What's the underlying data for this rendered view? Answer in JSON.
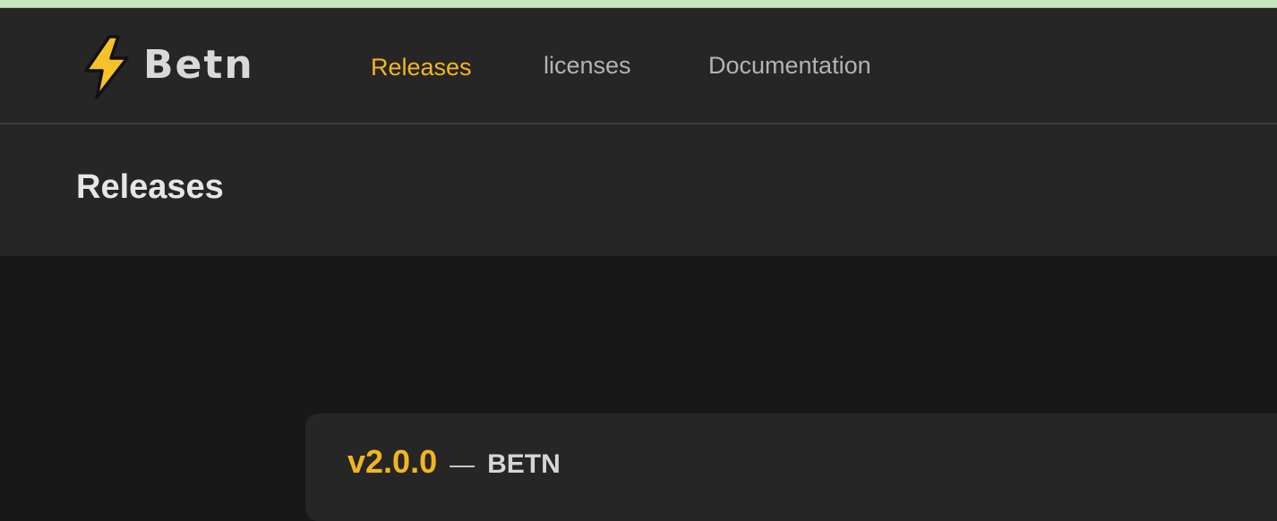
{
  "brand": {
    "name": "Betn",
    "logo_icon": "lightning-bolt-icon",
    "icon_color": "#f7c12a",
    "accent_color": "#f2b61f"
  },
  "nav": {
    "items": [
      {
        "label": "Releases",
        "active": true
      },
      {
        "label": "licenses",
        "active": false
      },
      {
        "label": "Documentation",
        "active": false
      }
    ]
  },
  "page": {
    "title": "Releases"
  },
  "releases": [
    {
      "version": "v2.0.0",
      "separator": "—",
      "name": "BETN"
    }
  ]
}
